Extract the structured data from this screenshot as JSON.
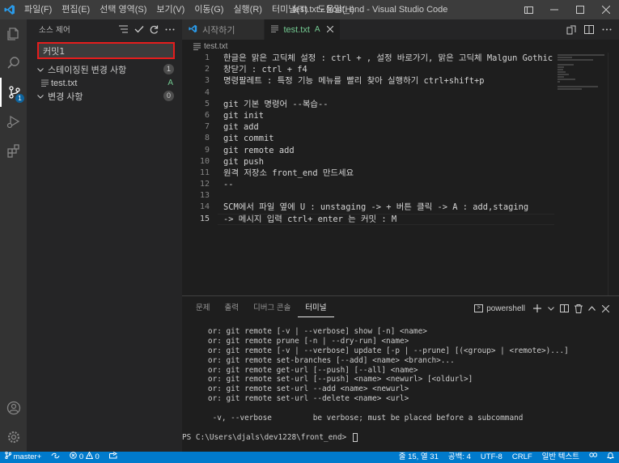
{
  "titlebar": {
    "menu": [
      "파일(F)",
      "편집(E)",
      "선택 영역(S)",
      "보기(V)",
      "이동(G)",
      "실행(R)",
      "터미널(T)",
      "도움말(H)"
    ],
    "title": "test.txt - front_end - Visual Studio Code"
  },
  "colors": {
    "accent": "#007acc",
    "highlight_border": "#e51d1d",
    "added_green": "#73c991"
  },
  "sidebar": {
    "title": "소스 제어",
    "commit_message": "커밋1",
    "staged": {
      "label": "스테이징된 변경 사항",
      "count": "1"
    },
    "staged_file": {
      "name": "test.txt",
      "status": "A"
    },
    "changes": {
      "label": "변경 사항",
      "count": "0"
    }
  },
  "activity_badge": "1",
  "tabs": [
    {
      "label": "시작하기"
    },
    {
      "label": "test.txt",
      "status": "A"
    }
  ],
  "breadcrumb": "test.txt",
  "editor": {
    "line_numbers": [
      "1",
      "2",
      "3",
      "4",
      "5",
      "6",
      "7",
      "8",
      "9",
      "10",
      "11",
      "12",
      "13",
      "14",
      "15"
    ],
    "lines": [
      "한글은 맑은 고딕체 설정 : ctrl + , 설정 바로가기, 맑은 고딕체 Malgun Gothic",
      "창닫기 : ctrl + f4",
      "명령팔레트 : 특정 기능 메뉴를 빨리 찾아 실행하기 ctrl+shift+p",
      "",
      "git 기본 명령어 --복습--",
      "git init",
      "git add",
      "git commit",
      "git remote add",
      "git push",
      "원격 저장소 front_end 만드세요",
      "--",
      "",
      "SCM에서 파일 옆에 U : unstaging -> + 버튼 클릭 -> A : add,staging",
      "-> 메시지 입력 ctrl+ enter 는 커밋 : M"
    ]
  },
  "panel": {
    "tabs": [
      "문제",
      "출력",
      "디버그 콘솔",
      "터미널"
    ],
    "terminal_name": "powershell",
    "terminal_lines": [
      "   or: git remote [-v | --verbose] show [-n] <name>",
      "   or: git remote prune [-n | --dry-run] <name>",
      "   or: git remote [-v | --verbose] update [-p | --prune] [(<group> | <remote>)...]",
      "   or: git remote set-branches [--add] <name> <branch>...",
      "   or: git remote get-url [--push] [--all] <name>",
      "   or: git remote set-url [--push] <name> <newurl> [<oldurl>]",
      "   or: git remote set-url --add <name> <newurl>",
      "   or: git remote set-url --delete <name> <url>",
      "",
      "    -v, --verbose         be verbose; must be placed before a subcommand",
      "",
      "PS C:\\Users\\djals\\dev1228\\front_end> "
    ]
  },
  "statusbar": {
    "branch": "master+",
    "errors": "0",
    "warnings": "0",
    "position": "줄 15, 열 31",
    "spaces": "공백: 4",
    "encoding": "UTF-8",
    "eol": "CRLF",
    "language": "일반 텍스트"
  }
}
